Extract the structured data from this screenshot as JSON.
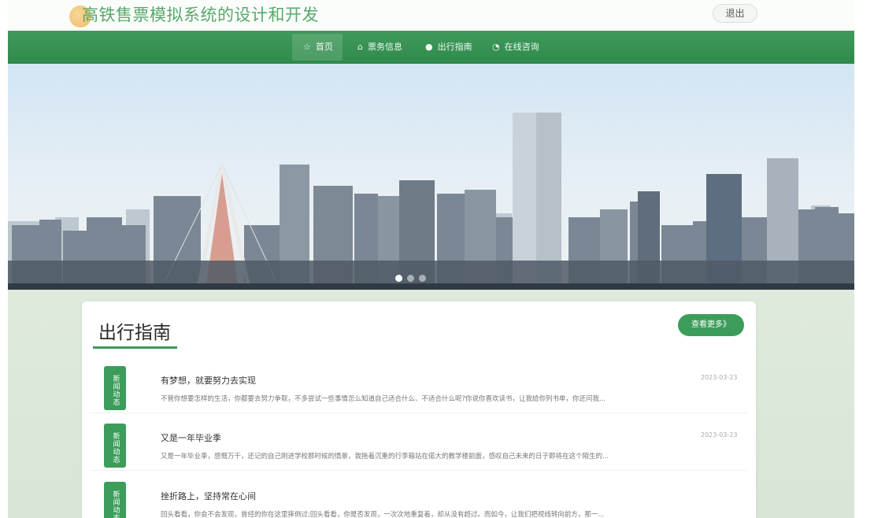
{
  "header": {
    "title": "高铁售票模拟系统的设计和开发",
    "logout_label": "退出"
  },
  "nav": {
    "items": [
      {
        "label": "首页",
        "icon": "star-icon",
        "active": true
      },
      {
        "label": "票务信息",
        "icon": "bag-icon",
        "active": false
      },
      {
        "label": "出行指南",
        "icon": "circle-icon",
        "active": false
      },
      {
        "label": "在线咨询",
        "icon": "chat-icon",
        "active": false
      }
    ]
  },
  "banner": {
    "slides": 3,
    "active_slide": 1
  },
  "section": {
    "title": "出行指南",
    "more_label": "查看更多》",
    "items": [
      {
        "badge": "新闻动态",
        "title": "有梦想，就要努力去实现",
        "date": "2023-03-23",
        "desc": "不管你想要怎样的生活，你都要去努力争取，不多尝试一些事情怎么知道自己适合什么、不适合什么呢?你说你喜欢读书，让我给你列书单，你还问我..."
      },
      {
        "badge": "新闻动态",
        "title": "又是一年毕业季",
        "date": "2023-03-23",
        "desc": "又是一年毕业季，感慨万千，还记的自己刚进学校那时候的情景，我拖着沉重的行李箱站在偌大的教学楼前面，感叹自己未来的日子即将在这个陌生的..."
      },
      {
        "badge": "新闻动态",
        "title": "挫折路上，坚持常在心间",
        "date": "",
        "desc": "回头看看，你会不会发现，曾经的你在这里摔倒过;回头看看，你是否发现，一次次地重复着，却从没有超过。而如今，让我们把视线转向前方，那一..."
      }
    ]
  },
  "colors": {
    "primary": "#3c9d5b",
    "nav": "#338e50",
    "title": "#57a86a"
  }
}
